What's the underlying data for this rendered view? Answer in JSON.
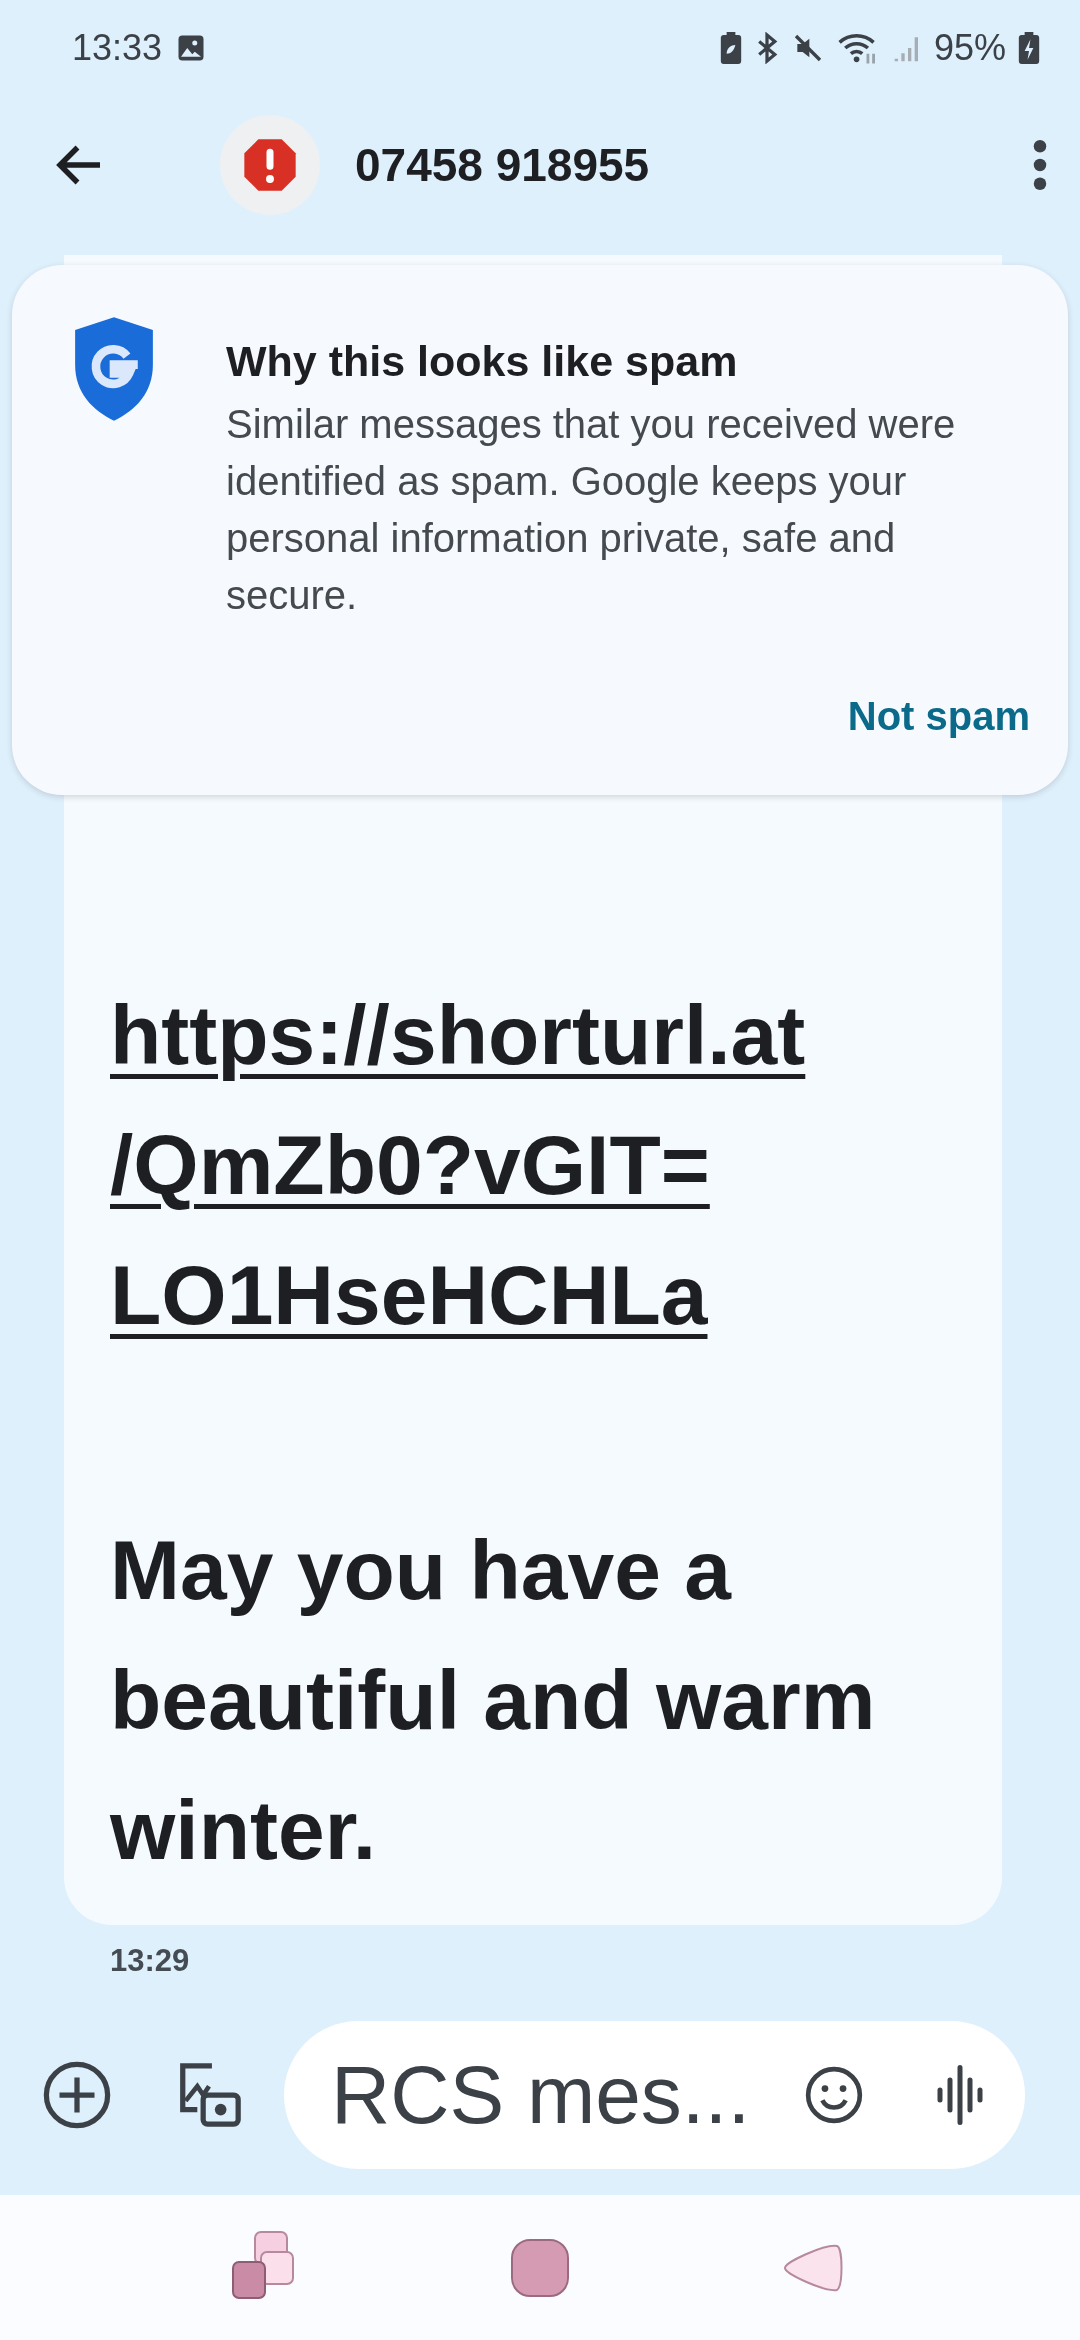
{
  "status_bar": {
    "time": "13:33",
    "battery": "95%"
  },
  "header": {
    "title": "07458 918955"
  },
  "spam_card": {
    "title": "Why this looks like spam",
    "body": "Similar messages that you received were identified as spam. Google keeps your personal information private, safe and secure.",
    "action": "Not spam"
  },
  "message": {
    "link_lines": [
      "https://shorturl.at",
      "/QmZb0?vGIT=",
      "LO1HseHCHLa"
    ],
    "text": "May you have a beautiful and warm winter.",
    "time": "13:29"
  },
  "composer": {
    "placeholder": "RCS mes..."
  }
}
